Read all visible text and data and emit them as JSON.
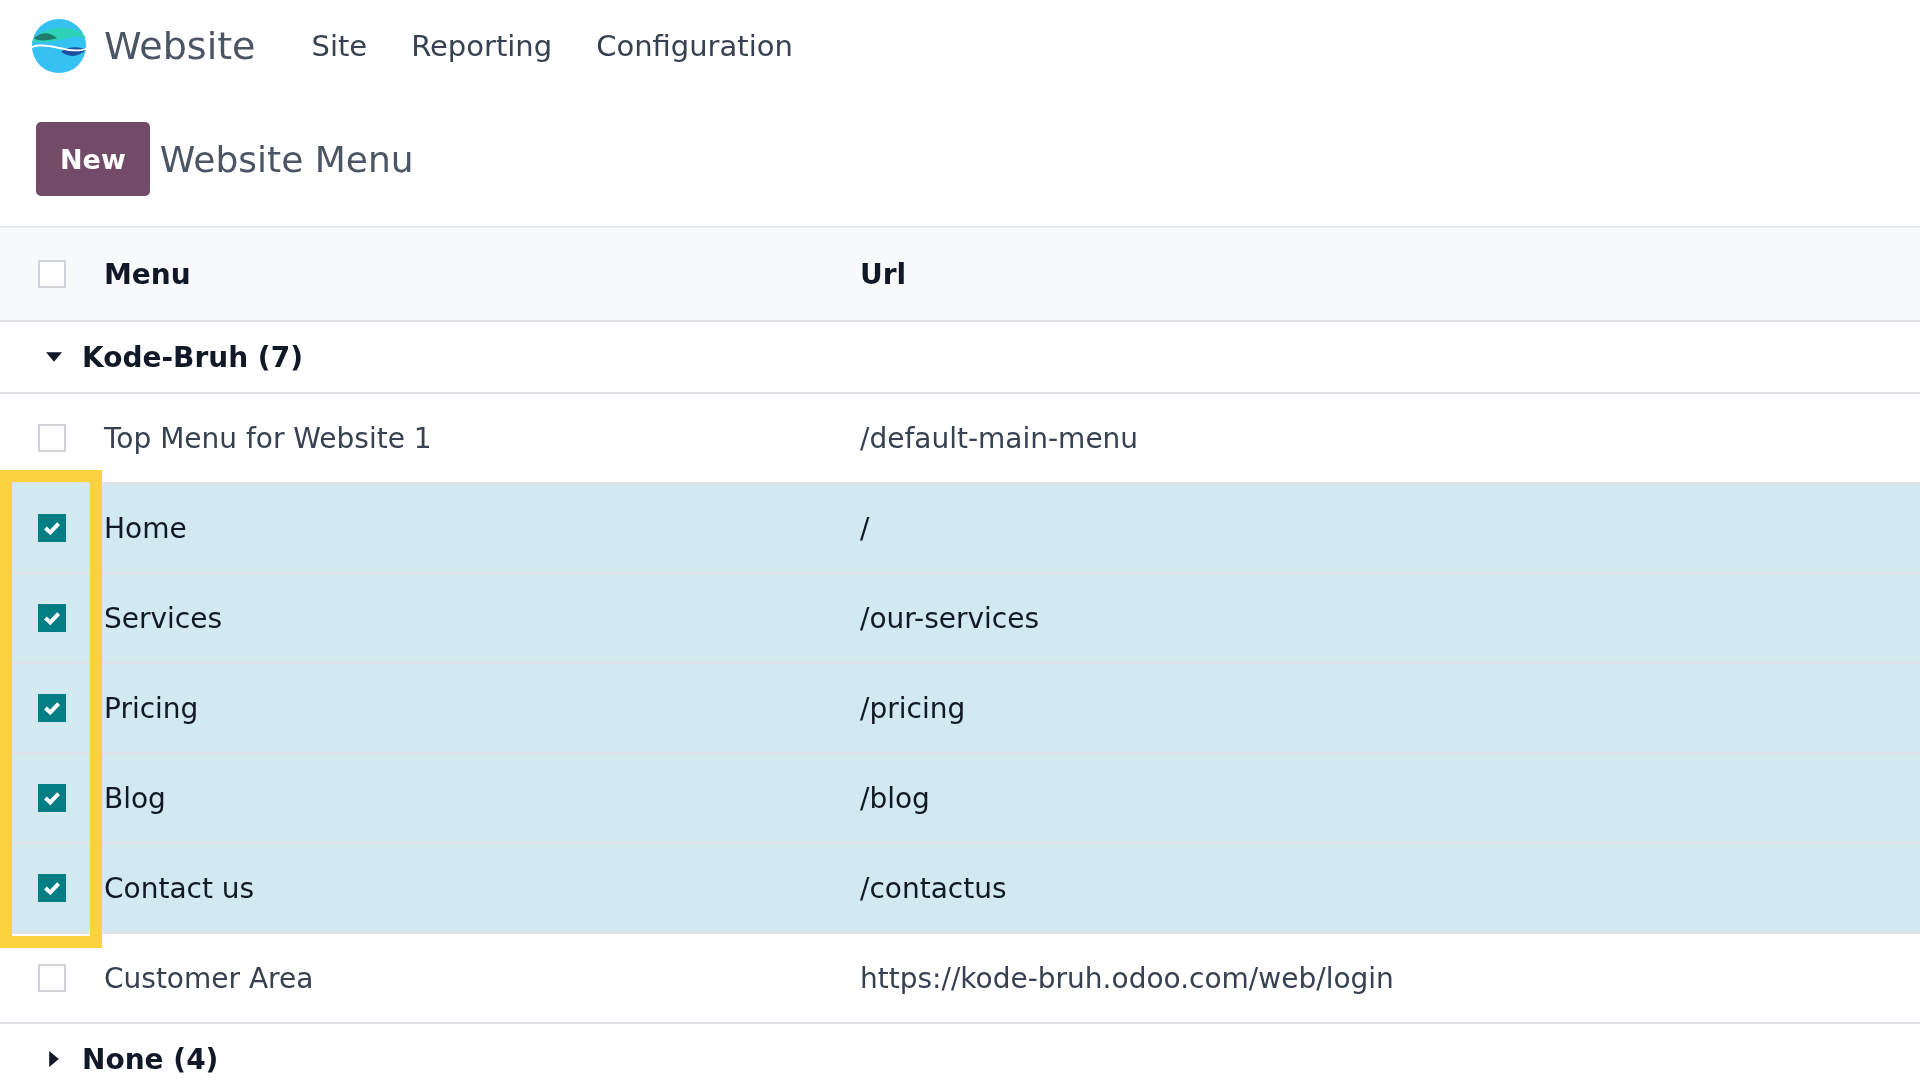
{
  "app": {
    "name": "Website",
    "menu": [
      "Site",
      "Reporting",
      "Configuration"
    ]
  },
  "control_panel": {
    "new_button": "New",
    "title": "Website Menu"
  },
  "table": {
    "select_all": {
      "checked": false
    },
    "columns": [
      "Menu",
      "Url"
    ],
    "groups": [
      {
        "label": "Kode-Bruh (7)",
        "expanded": true,
        "rows": [
          {
            "menu": "Top Menu for Website 1",
            "url": "/default-main-menu",
            "checked": false
          },
          {
            "menu": "Home",
            "url": "/",
            "checked": true
          },
          {
            "menu": "Services",
            "url": "/our-services",
            "checked": true
          },
          {
            "menu": "Pricing",
            "url": "/pricing",
            "checked": true
          },
          {
            "menu": "Blog",
            "url": "/blog",
            "checked": true
          },
          {
            "menu": "Contact us",
            "url": "/contactus",
            "checked": true
          },
          {
            "menu": "Customer Area",
            "url": "https://kode-bruh.odoo.com/web/login",
            "checked": false
          }
        ]
      },
      {
        "label": "None (4)",
        "expanded": false
      }
    ]
  }
}
